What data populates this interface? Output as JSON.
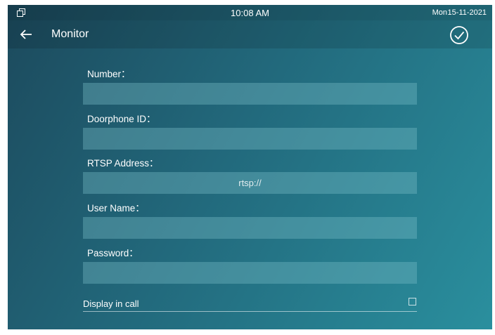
{
  "status_bar": {
    "icon": "window-restore-icon",
    "time": "10:08 AM",
    "day": "Mon",
    "date": "15-11-2021"
  },
  "header": {
    "back_icon": "arrow-left-icon",
    "title": "Monitor",
    "confirm_icon": "check-circle-icon"
  },
  "form": {
    "number": {
      "label": "Number：",
      "value": ""
    },
    "doorphone_id": {
      "label": "Doorphone ID：",
      "value": ""
    },
    "rtsp_address": {
      "label": "RTSP Address：",
      "value": "",
      "placeholder": "rtsp://"
    },
    "user_name": {
      "label": "User Name：",
      "value": ""
    },
    "password": {
      "label": "Password：",
      "value": ""
    }
  },
  "display_in_call": {
    "label": "Display in call",
    "checked": false
  },
  "colors": {
    "background_start": "#1c4a5d",
    "background_end": "#2a8f9e",
    "input_fill": "#5fa3ad",
    "text": "#ffffff"
  }
}
